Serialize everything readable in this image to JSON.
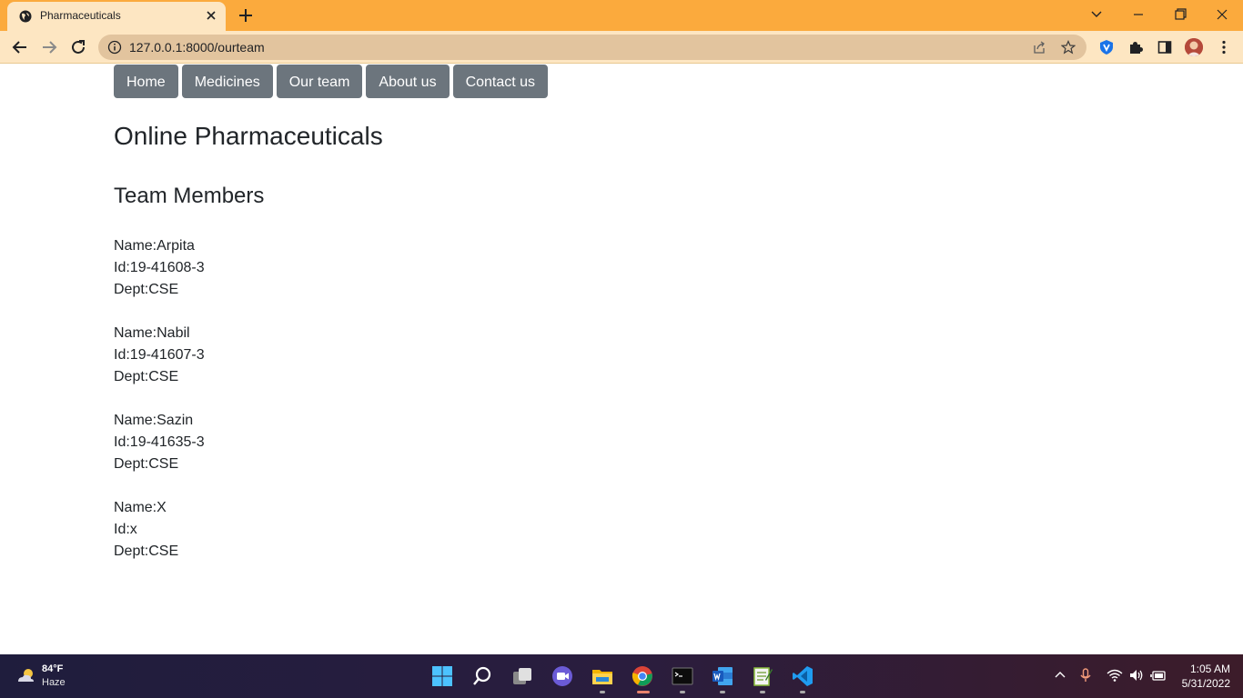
{
  "browser": {
    "tab_title": "Pharmaceuticals",
    "url": "127.0.0.1:8000/ourteam"
  },
  "nav": {
    "items": [
      "Home",
      "Medicines",
      "Our team",
      "About us",
      "Contact us"
    ]
  },
  "site_title": "Online Pharmaceuticals",
  "section_title": "Team Members",
  "members": [
    {
      "name": "Name:Arpita",
      "id": "Id:19-41608-3",
      "dept": "Dept:CSE"
    },
    {
      "name": "Name:Nabil",
      "id": "Id:19-41607-3",
      "dept": "Dept:CSE"
    },
    {
      "name": "Name:Sazin",
      "id": "Id:19-41635-3",
      "dept": "Dept:CSE"
    },
    {
      "name": "Name:X",
      "id": "Id:x",
      "dept": "Dept:CSE"
    }
  ],
  "taskbar": {
    "weather_temp": "84°F",
    "weather_condition": "Haze",
    "time": "1:05 AM",
    "date": "5/31/2022"
  },
  "colors": {
    "tabstrip": "#fbaa3d",
    "toolbar": "#fde6c2",
    "nav_button": "#6c757d"
  }
}
